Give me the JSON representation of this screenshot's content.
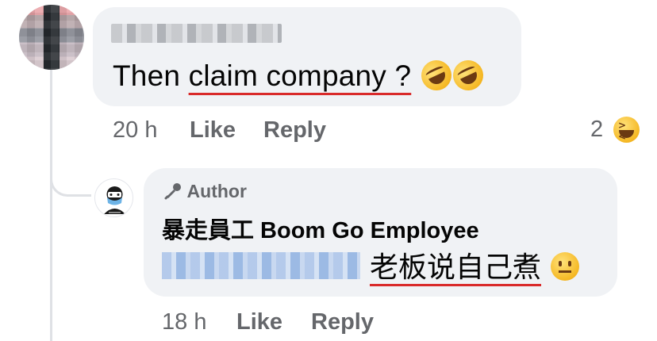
{
  "comment": {
    "text_prefix": "Then ",
    "text_underlined": "claim company ?",
    "emojis": [
      "rolling-on-floor-laughing",
      "rolling-on-floor-laughing"
    ],
    "timestamp": "20 h",
    "like_label": "Like",
    "reply_label": "Reply",
    "reaction_count": "2",
    "reaction_emoji": "laughing-squinting"
  },
  "reply": {
    "badge_label": "Author",
    "author_name": "暴走員工 Boom Go Employee",
    "text": "老板说自己煮",
    "emoji": "neutral-face",
    "timestamp": "18 h",
    "like_label": "Like",
    "reply_label": "Reply"
  },
  "colors": {
    "bubble": "#f0f2f5",
    "meta_text": "#65676b",
    "underline": "#d92a2a",
    "thread_line": "#dfe1e5"
  }
}
